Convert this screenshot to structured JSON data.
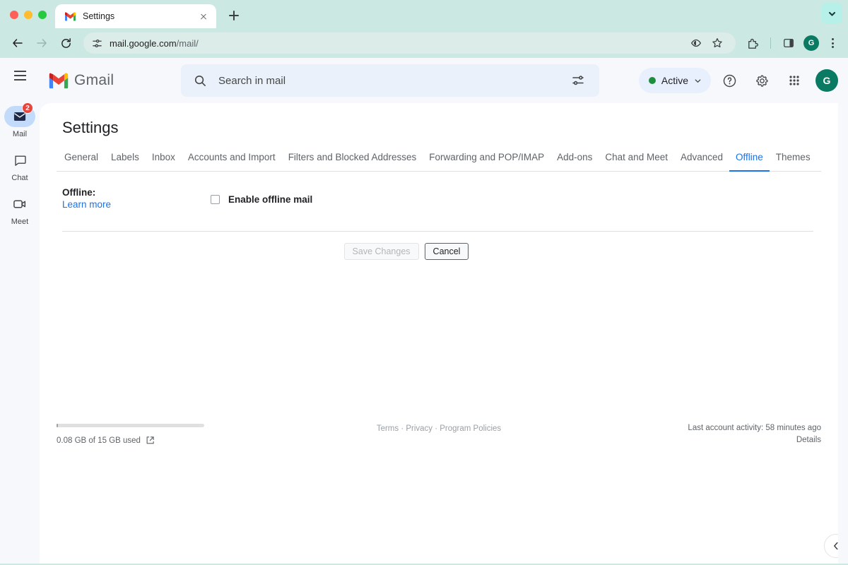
{
  "browser": {
    "tab": {
      "title": "Settings",
      "favicon": "gmail-icon",
      "close": "close-icon"
    },
    "new_tab": "new-tab-icon",
    "corner_chevron": "chevron-down-icon",
    "nav": {
      "back": "back-arrow-icon",
      "forward": "forward-arrow-icon",
      "reload": "reload-icon"
    },
    "address": {
      "site_icon": "page-settings-icon",
      "domain": "mail.google.com",
      "path": "/mail/"
    },
    "toolbar_icons": [
      "tracking-protection-icon",
      "bookmark-star-icon",
      "extensions-icon",
      "side-panel-icon"
    ],
    "profile_initial": "G",
    "menu": "kebab-menu-icon"
  },
  "rail": {
    "menu": "hamburger-icon",
    "items": [
      {
        "label": "Mail",
        "icon": "mail-icon",
        "badge": "2",
        "active": true
      },
      {
        "label": "Chat",
        "icon": "chat-icon",
        "badge": "",
        "active": false
      },
      {
        "label": "Meet",
        "icon": "meet-icon",
        "badge": "",
        "active": false
      }
    ]
  },
  "header": {
    "logo_text": "Gmail",
    "search": {
      "icon": "search-icon",
      "placeholder": "Search in mail",
      "filter_icon": "tune-icon"
    },
    "status": {
      "label": "Active",
      "dot_color": "#1e8e3e",
      "chevron": "chevron-down-icon"
    },
    "help": "help-icon",
    "settings": "gear-icon",
    "apps": "apps-grid-icon",
    "avatar_initial": "G"
  },
  "page": {
    "title": "Settings",
    "tabs": [
      {
        "label": "General",
        "active": false
      },
      {
        "label": "Labels",
        "active": false
      },
      {
        "label": "Inbox",
        "active": false
      },
      {
        "label": "Accounts and Import",
        "active": false
      },
      {
        "label": "Filters and Blocked Addresses",
        "active": false
      },
      {
        "label": "Forwarding and POP/IMAP",
        "active": false
      },
      {
        "label": "Add-ons",
        "active": false
      },
      {
        "label": "Chat and Meet",
        "active": false
      },
      {
        "label": "Advanced",
        "active": false
      },
      {
        "label": "Offline",
        "active": true
      },
      {
        "label": "Themes",
        "active": false
      }
    ],
    "active_tab": "Offline",
    "offline": {
      "section_label": "Offline:",
      "learn_more": "Learn more",
      "checkbox_label": "Enable offline mail",
      "checkbox_checked": false
    },
    "buttons": {
      "save": "Save Changes",
      "save_disabled": true,
      "cancel": "Cancel"
    }
  },
  "footer": {
    "storage_text": "0.08 GB of 15 GB used",
    "storage_icon": "external-link-icon",
    "links": "Terms · Privacy · Program Policies",
    "activity": "Last account activity: 58 minutes ago",
    "details": "Details",
    "collapse_icon": "chevron-left-icon"
  },
  "colors": {
    "accent": "#1a73e8",
    "chrome_bg": "#cce8e2",
    "badge": "#e8453c",
    "avatar": "#0b7a62"
  }
}
